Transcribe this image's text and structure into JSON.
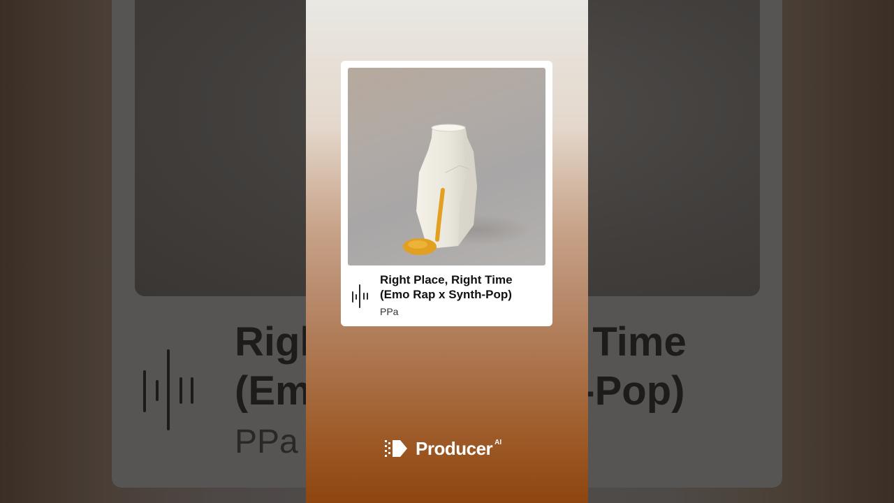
{
  "track": {
    "title_line1": "Right Place, Right Time",
    "title_line2": "(Emo Rap x Synth-Pop)",
    "artist": "PPa"
  },
  "background_text": {
    "title_line1": "Right Place, Right Time",
    "title_line2": "(Emo Rap x Synth-Pop)",
    "artist": "PPa"
  },
  "brand": {
    "name": "Producer",
    "superscript": "AI"
  },
  "icons": {
    "waveform": "waveform-icon",
    "brand_logo": "producer-logo-icon"
  },
  "colors": {
    "card_bg": "#ffffff",
    "gradient_top": "#e9e8e3",
    "gradient_bottom": "#8e4610",
    "honey": "#e2a020"
  }
}
